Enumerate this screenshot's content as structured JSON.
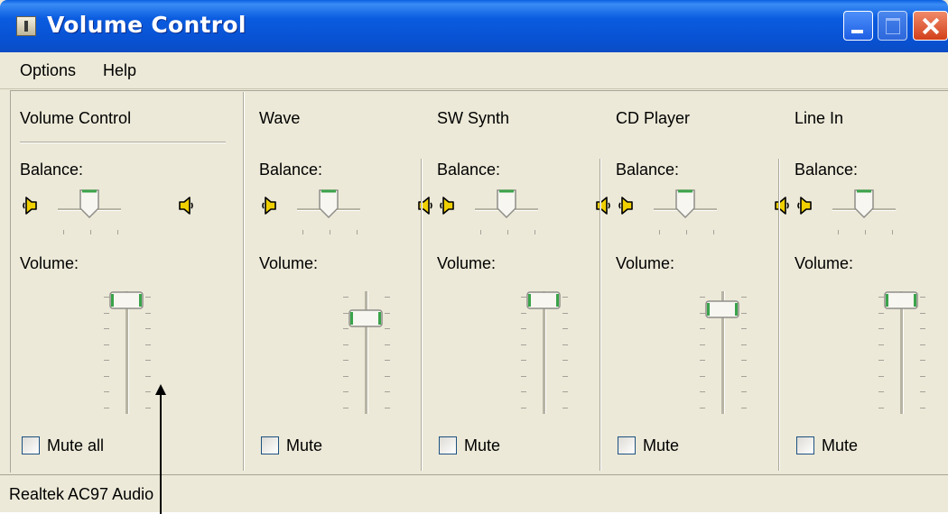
{
  "window": {
    "title": "Volume Control",
    "icon": "speaker-app-icon"
  },
  "menu": {
    "items": [
      "Options",
      "Help"
    ]
  },
  "columns": [
    {
      "title": "Volume Control",
      "balance_label": "Balance:",
      "volume_label": "Volume:",
      "mute_label": "Mute all",
      "mute_checked": false,
      "balance": 0.5,
      "volume_level": 1.0
    },
    {
      "title": "Wave",
      "balance_label": "Balance:",
      "volume_label": "Volume:",
      "mute_label": "Mute",
      "mute_checked": false,
      "balance": 0.5,
      "volume_level": 0.83
    },
    {
      "title": "SW Synth",
      "balance_label": "Balance:",
      "volume_label": "Volume:",
      "mute_label": "Mute",
      "mute_checked": false,
      "balance": 0.5,
      "volume_level": 1.0
    },
    {
      "title": "CD Player",
      "balance_label": "Balance:",
      "volume_label": "Volume:",
      "mute_label": "Mute",
      "mute_checked": false,
      "balance": 0.5,
      "volume_level": 0.91
    },
    {
      "title": "Line In",
      "balance_label": "Balance:",
      "volume_label": "Volume:",
      "mute_label": "Mute",
      "mute_checked": false,
      "balance": 0.5,
      "volume_level": 1.0
    }
  ],
  "status": {
    "text": "Realtek AC97 Audio"
  },
  "colors": {
    "title_bar": "#0a55d8",
    "face": "#ece9d8",
    "thumb_accent": "#2e9e3e",
    "speaker": "#e8c800"
  }
}
